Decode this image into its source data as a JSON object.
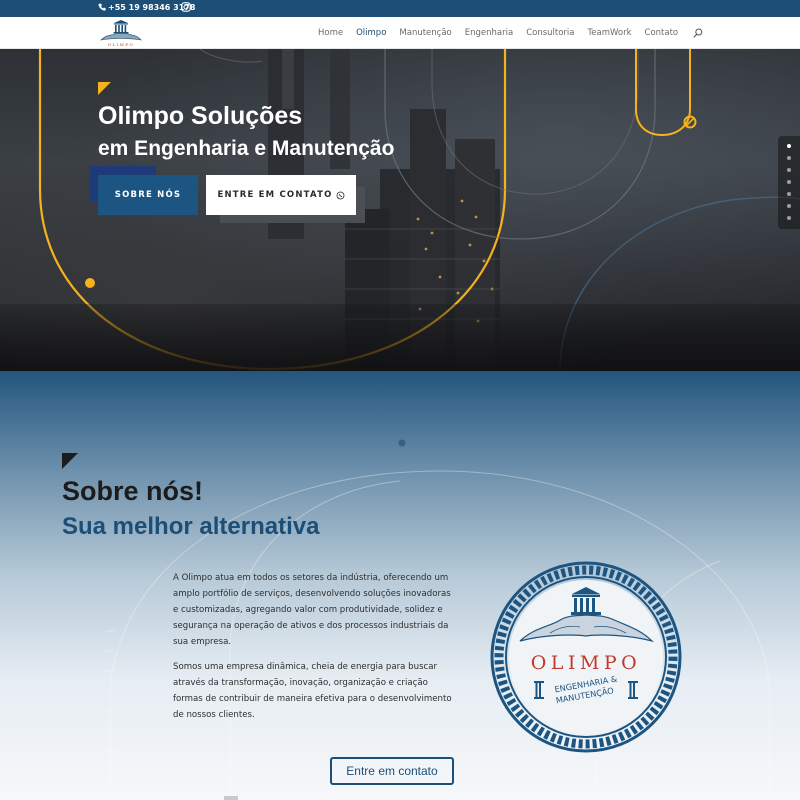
{
  "topbar": {
    "phone": "+55 19 98346 3178",
    "instagram_icon": "instagram-icon",
    "background": "#1d4e75"
  },
  "header": {
    "logo_icon": "olimpo-temple-logo",
    "nav": [
      {
        "label": "Home",
        "active": false
      },
      {
        "label": "Olimpo",
        "active": true
      },
      {
        "label": "Manutenção",
        "active": false
      },
      {
        "label": "Engenharia",
        "active": false
      },
      {
        "label": "Consultoria",
        "active": false
      },
      {
        "label": "TeamWork",
        "active": false
      },
      {
        "label": "Contato",
        "active": false
      }
    ],
    "search_icon": "search-icon",
    "active_color": "#1d4e75"
  },
  "hero": {
    "title_line1": "Olimpo Soluções",
    "title_line2": "em Engenharia e Manutenção",
    "button_about": "SOBRE NÓS",
    "button_contact": "ENTRE EM CONTATO",
    "contact_icon": "whatsapp-icon",
    "accent": "#f5b21c",
    "slide_count": 7,
    "active_slide": 1
  },
  "about": {
    "heading": "Sobre nós!",
    "subheading": "Sua melhor alternativa",
    "paragraph1": "A Olimpo atua em todos os setores da indústria, oferecendo um amplo portfólio de serviços, desenvolvendo soluções inovadoras e customizadas, agregando valor com produtividade, solidez e segurança na operação de ativos e dos processos industriais da sua empresa.",
    "paragraph2": "Somos uma empresa dinâmica, cheia de energia para buscar através da transformação, inovação, organização e criação formas de contribuir de maneira efetiva para o desenvolvimento de nossos clientes.",
    "badge": {
      "name": "OLIMPO",
      "tagline_line1": "ENGENHARIA &",
      "tagline_line2": "MANUTENÇÃO"
    },
    "button": "Entre em contato",
    "brand_color": "#1d4e75",
    "badge_red": "#c0392b"
  }
}
